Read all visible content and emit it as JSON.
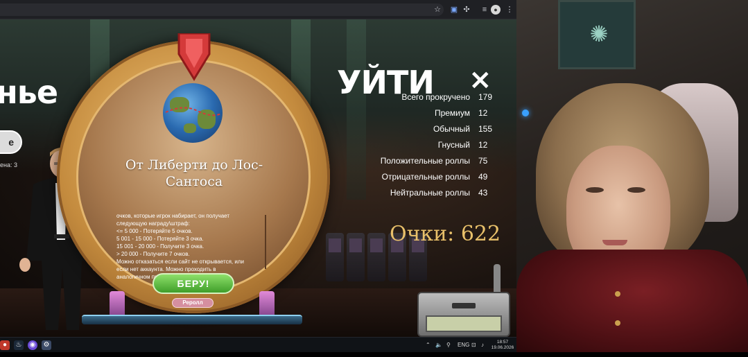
{
  "browser": {
    "icons": [
      "star-icon",
      "extension-icon",
      "puzzle-icon",
      "media-icon",
      "profile-icon",
      "menu-icon"
    ]
  },
  "game": {
    "left_partial_title": "ньe",
    "left_pill_text": "e",
    "left_pill_note": "ена: 3",
    "wheel": {
      "title_line1": "От Либерти до Лос-",
      "title_line2": "Сантоса",
      "description": [
        "очков, которые игрок набирает, он получает",
        "следующую награду\\штраф:",
        "<= 5 000 - Потеряйте 5 очков.",
        "5 001 - 15 000 - Потеряйте 3 очка.",
        "15 001 - 20 000 - Получите 3 очка.",
        "> 20 000 - Получите 7 очков.",
        "Можно отказаться если сайт не открывается, или",
        "если нет аккаунта. Можно проходить в",
        "аналогичном приложении в Steam."
      ],
      "take_button": "БЕРУ!",
      "reroll_button": "Реролл"
    },
    "quit_title": "УЙТИ",
    "quit_close": "×",
    "stats": [
      {
        "label": "Всего прокручено",
        "value": "179"
      },
      {
        "label": "Премиум",
        "value": "12"
      },
      {
        "label": "Обычный",
        "value": "155"
      },
      {
        "label": "Гнусный",
        "value": "12"
      },
      {
        "label": "Положительные роллы",
        "value": "75"
      },
      {
        "label": "Отрицательные роллы",
        "value": "49"
      },
      {
        "label": "Нейтральные роллы",
        "value": "43"
      }
    ],
    "score_label": "Очки:",
    "score_value": "622"
  },
  "taskbar": {
    "language": "ENG",
    "time": "18:57",
    "date": "19.06.2026"
  },
  "colors": {
    "score_gold": "#e8c06a",
    "take_green": "#4fb035",
    "reroll_pink": "#d58fa0",
    "pointer_red": "#d43a3a"
  }
}
